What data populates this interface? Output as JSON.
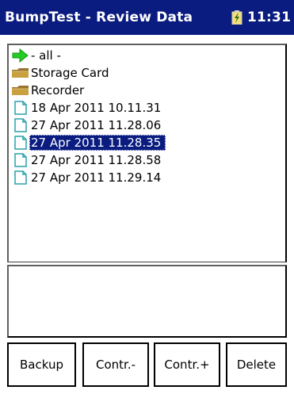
{
  "titlebar": {
    "title": "BumpTest - Review Data",
    "clock": "11:31",
    "battery_icon": "battery-charging-icon"
  },
  "file_list": {
    "items": [
      {
        "label": "- all -",
        "icon": "green-arrow-icon",
        "selected": false
      },
      {
        "label": "Storage Card",
        "icon": "folder-icon",
        "selected": false
      },
      {
        "label": "Recorder",
        "icon": "folder-icon",
        "selected": false
      },
      {
        "label": "18 Apr 2011 10.11.31",
        "icon": "document-icon",
        "selected": false
      },
      {
        "label": "27 Apr 2011 11.28.06",
        "icon": "document-icon",
        "selected": false
      },
      {
        "label": "27 Apr 2011 11.28.35",
        "icon": "document-icon",
        "selected": true
      },
      {
        "label": "27 Apr 2011 11.28.58",
        "icon": "document-icon",
        "selected": false
      },
      {
        "label": "27 Apr 2011 11.29.14",
        "icon": "document-icon",
        "selected": false
      }
    ]
  },
  "buttons": {
    "backup": "Backup",
    "contr_minus": "Contr.-",
    "contr_plus": "Contr.+",
    "delete": "Delete"
  },
  "colors": {
    "titlebar_bg": "#0a1c80",
    "selection_bg": "#0a1c80",
    "arrow_green": "#22cc22",
    "folder_brown": "#c8a040",
    "document_teal": "#2aa0a8"
  }
}
